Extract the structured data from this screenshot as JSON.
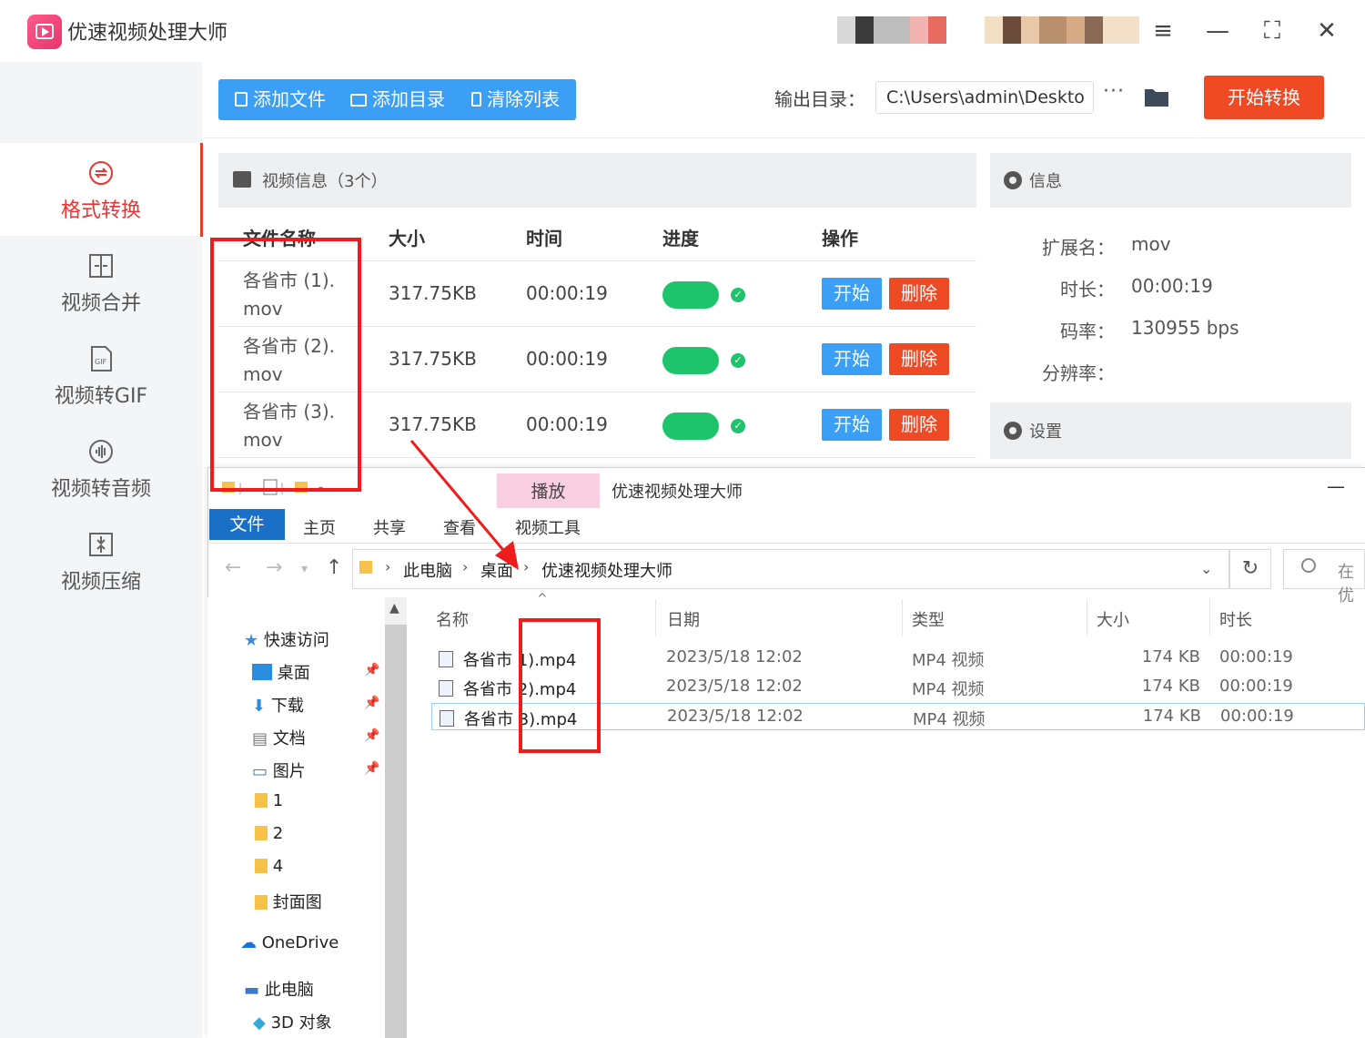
{
  "app": {
    "title": "优速视频处理大师",
    "window_controls": [
      "≡",
      "—",
      "⛶",
      "✕"
    ]
  },
  "sidebar": {
    "items": [
      {
        "label": "格式转换",
        "icon": "convert-icon",
        "active": true
      },
      {
        "label": "视频合并",
        "icon": "merge-icon"
      },
      {
        "label": "视频转GIF",
        "icon": "gif-icon",
        "icon_text": "GIF"
      },
      {
        "label": "视频转音频",
        "icon": "audio-icon"
      },
      {
        "label": "视频压缩",
        "icon": "compress-icon"
      }
    ]
  },
  "toolbar": {
    "add_file": "添加文件",
    "add_folder": "添加目录",
    "clear_list": "清除列表",
    "output_label": "输出目录：",
    "output_path": "C:\\Users\\admin\\Deskto",
    "more": "···",
    "start_convert": "开始转换"
  },
  "video_list": {
    "title": "视频信息（3个）",
    "columns": [
      "文件名称",
      "大小",
      "时间",
      "进度",
      "操作"
    ],
    "rows": [
      {
        "name_line1": "各省市 (1).",
        "name_line2": "mov",
        "size": "317.75KB",
        "time": "00:00:19",
        "progress": 1.0,
        "start": "开始",
        "delete": "删除"
      },
      {
        "name_line1": "各省市 (2).",
        "name_line2": "mov",
        "size": "317.75KB",
        "time": "00:00:19",
        "progress": 1.0,
        "start": "开始",
        "delete": "删除"
      },
      {
        "name_line1": "各省市 (3).",
        "name_line2": "mov",
        "size": "317.75KB",
        "time": "00:00:19",
        "progress": 1.0,
        "start": "开始",
        "delete": "删除"
      }
    ]
  },
  "info": {
    "title": "信息",
    "fields": [
      {
        "key": "扩展名：",
        "value": "mov"
      },
      {
        "key": "时长：",
        "value": "00:00:19"
      },
      {
        "key": "码率：",
        "value": "130955 bps"
      },
      {
        "key": "分辨率：",
        "value": ""
      }
    ],
    "settings_title": "设置"
  },
  "explorer": {
    "title": "优速视频处理大师",
    "context_tab": "播放",
    "ribbon_tabs": [
      "文件",
      "主页",
      "共享",
      "查看"
    ],
    "context_sub_tab": "视频工具",
    "minimize": "—",
    "breadcrumb": [
      "此电脑",
      "桌面",
      "优速视频处理大师"
    ],
    "search_placeholder": "在 优",
    "nav_items": [
      {
        "label": "快速访问",
        "icon": "star-icon"
      },
      {
        "label": "桌面",
        "icon": "desktop-icon",
        "pinned": true
      },
      {
        "label": "下载",
        "icon": "download-icon",
        "pinned": true
      },
      {
        "label": "文档",
        "icon": "document-icon",
        "pinned": true
      },
      {
        "label": "图片",
        "icon": "picture-icon",
        "pinned": true
      },
      {
        "label": "1",
        "icon": "folder-icon"
      },
      {
        "label": "2",
        "icon": "folder-icon"
      },
      {
        "label": "4",
        "icon": "folder-icon"
      },
      {
        "label": "封面图",
        "icon": "folder-icon"
      },
      {
        "label": "OneDrive",
        "icon": "cloud-icon"
      },
      {
        "label": "此电脑",
        "icon": "pc-icon"
      },
      {
        "label": "3D 对象",
        "icon": "cube-icon"
      }
    ],
    "columns": [
      "名称",
      "日期",
      "类型",
      "大小",
      "时长"
    ],
    "files": [
      {
        "name": "各省市 1).mp4",
        "date": "2023/5/18 12:02",
        "type": "MP4 视频",
        "size": "174 KB",
        "duration": "00:00:19"
      },
      {
        "name": "各省市 2).mp4",
        "date": "2023/5/18 12:02",
        "type": "MP4 视频",
        "size": "174 KB",
        "duration": "00:00:19"
      },
      {
        "name": "各省市 3).mp4",
        "date": "2023/5/18 12:02",
        "type": "MP4 视频",
        "size": "174 KB",
        "duration": "00:00:19",
        "selected": true
      }
    ]
  },
  "colors": {
    "primary_blue": "#3a9ff5",
    "danger_red": "#f04a24",
    "success_green": "#1ec46b",
    "annotation_red": "#ee1c1c",
    "active_label": "#e33333"
  }
}
